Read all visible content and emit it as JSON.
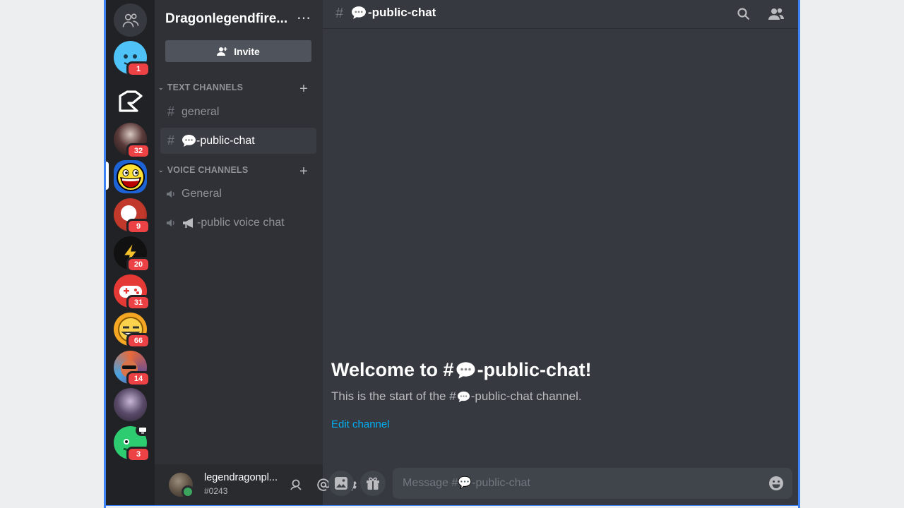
{
  "guild": {
    "name": "Dragonlegendfire...",
    "invite_label": "Invite"
  },
  "servers": [
    {
      "badge": "1",
      "color": "#4fc3f7"
    },
    {
      "badge": "",
      "color": "#202225"
    },
    {
      "badge": "32",
      "color": "#3a2a2a"
    },
    {
      "badge": "",
      "color": "#1e63d6"
    },
    {
      "badge": "9",
      "color": "#c0392b"
    },
    {
      "badge": "20",
      "color": "#1a1a1a"
    },
    {
      "badge": "31",
      "color": "#e53935"
    },
    {
      "badge": "66",
      "color": "#f5a623"
    },
    {
      "badge": "14",
      "color": "#6a4c93"
    },
    {
      "badge": "",
      "color": "#4b3b5b"
    },
    {
      "badge": "3",
      "color": "#2ecc71"
    }
  ],
  "categories": {
    "text": "TEXT CHANNELS",
    "voice": "VOICE CHANNELS"
  },
  "text_channels": [
    {
      "name": "general"
    },
    {
      "name": "-public-chat"
    }
  ],
  "voice_channels": [
    {
      "name": "General"
    },
    {
      "name": "-public voice chat"
    }
  ],
  "user": {
    "name": "legendragonpl...",
    "tag": "#0243"
  },
  "topbar": {
    "channel": "-public-chat"
  },
  "welcome": {
    "title_prefix": "Welcome to #",
    "title_suffix": "-public-chat!",
    "sub_prefix": "This is the start of the #",
    "sub_suffix": "-public-chat channel.",
    "edit_label": "Edit channel"
  },
  "composer": {
    "placeholder": "Message #💬-public-chat"
  },
  "colors": {
    "accent": "#5865f2",
    "link": "#00aff4",
    "badge": "#ed4245",
    "online": "#3ba55d"
  }
}
